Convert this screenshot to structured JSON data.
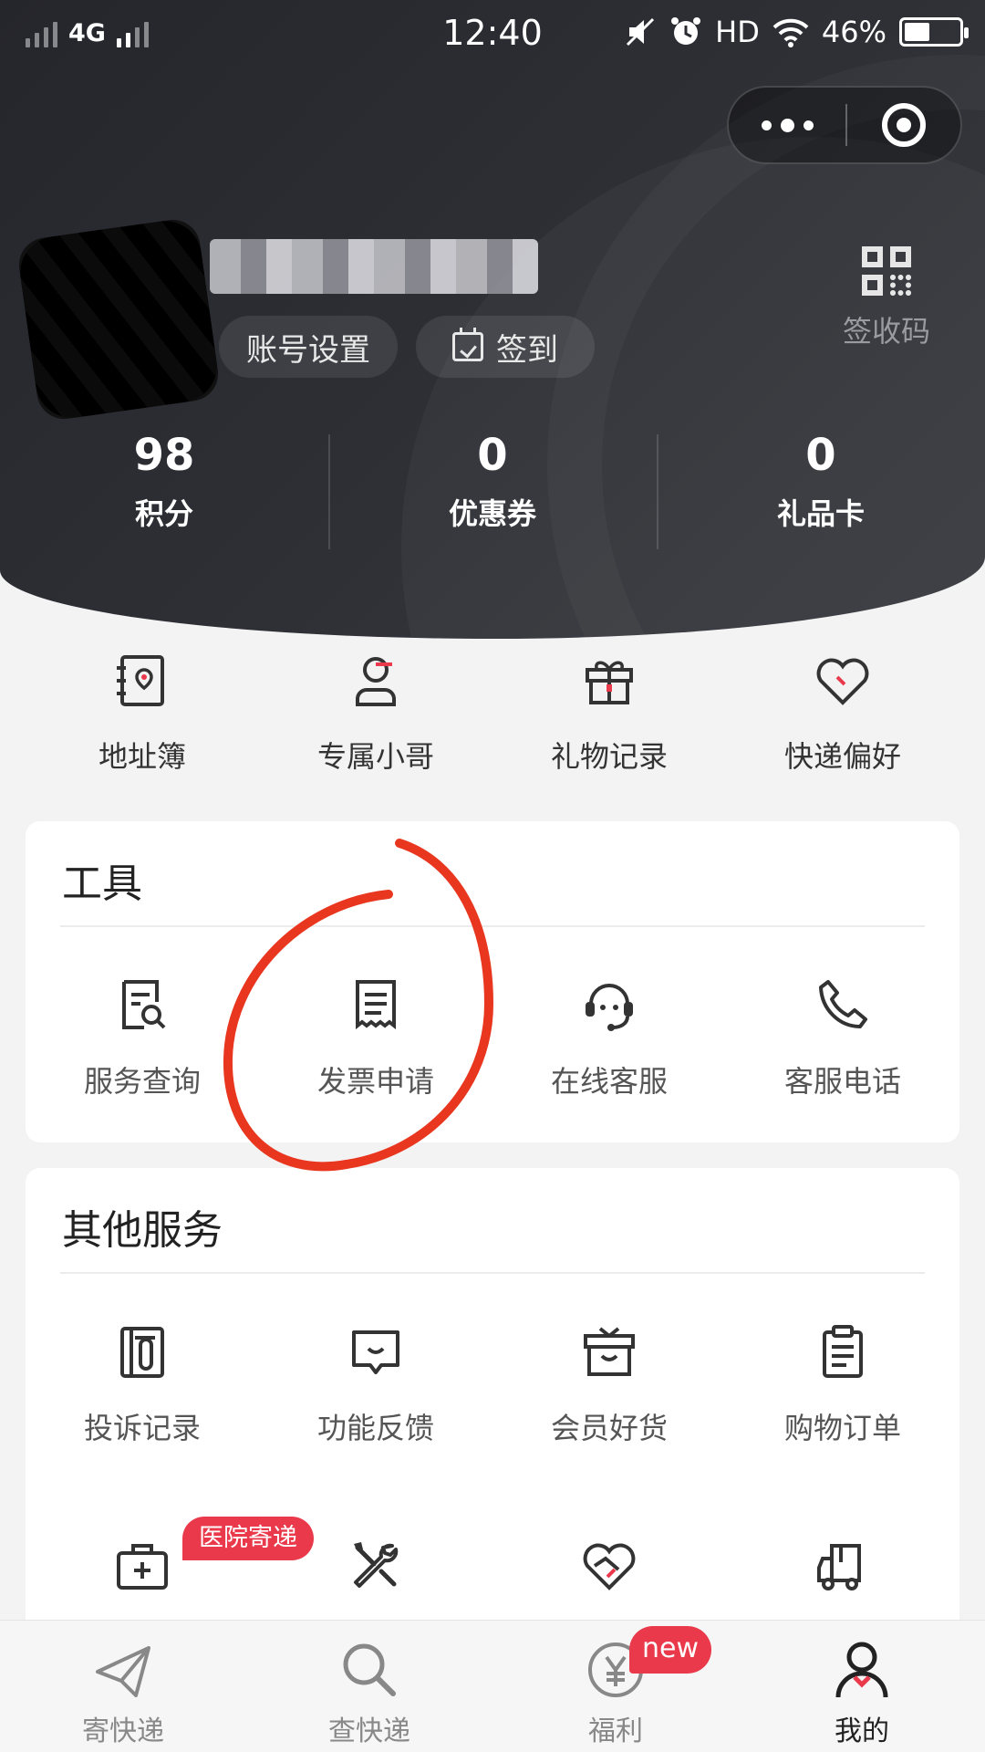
{
  "status_bar": {
    "network": "4G",
    "time": "12:40",
    "hd": "HD",
    "battery_percent": "46%",
    "battery_level": 0.46
  },
  "profile": {
    "account_settings": "账号设置",
    "sign_in": "签到",
    "qr_label": "签收码"
  },
  "stats": [
    {
      "value": "98",
      "label": "积分"
    },
    {
      "value": "0",
      "label": "优惠券"
    },
    {
      "value": "0",
      "label": "礼品卡"
    }
  ],
  "quick_actions": [
    {
      "label": "地址簿",
      "icon": "address-book-icon"
    },
    {
      "label": "专属小哥",
      "icon": "courier-icon"
    },
    {
      "label": "礼物记录",
      "icon": "gift-icon"
    },
    {
      "label": "快递偏好",
      "icon": "heart-icon"
    }
  ],
  "tools": {
    "title": "工具",
    "items": [
      {
        "label": "服务查询",
        "icon": "service-search-icon"
      },
      {
        "label": "发票申请",
        "icon": "invoice-icon"
      },
      {
        "label": "在线客服",
        "icon": "headset-icon"
      },
      {
        "label": "客服电话",
        "icon": "phone-icon"
      }
    ]
  },
  "other_services": {
    "title": "其他服务",
    "items": [
      {
        "label": "投诉记录",
        "icon": "complaint-icon"
      },
      {
        "label": "功能反馈",
        "icon": "feedback-icon"
      },
      {
        "label": "会员好货",
        "icon": "member-goods-icon"
      },
      {
        "label": "购物订单",
        "icon": "clipboard-icon"
      }
    ],
    "items_row2": [
      {
        "icon": "medical-kit-icon",
        "badge": "医院寄递"
      },
      {
        "icon": "tools-icon"
      },
      {
        "icon": "charity-heart-icon"
      },
      {
        "icon": "truck-icon"
      }
    ]
  },
  "bottom_nav": [
    {
      "label": "寄快递",
      "icon": "send-icon"
    },
    {
      "label": "查快递",
      "icon": "search-icon"
    },
    {
      "label": "福利",
      "icon": "yuan-icon",
      "badge": "new"
    },
    {
      "label": "我的",
      "icon": "user-icon",
      "active": true
    }
  ],
  "colors": {
    "header_bg": "#2b2c31",
    "accent": "#e9394b",
    "annotation": "#e8361f"
  }
}
